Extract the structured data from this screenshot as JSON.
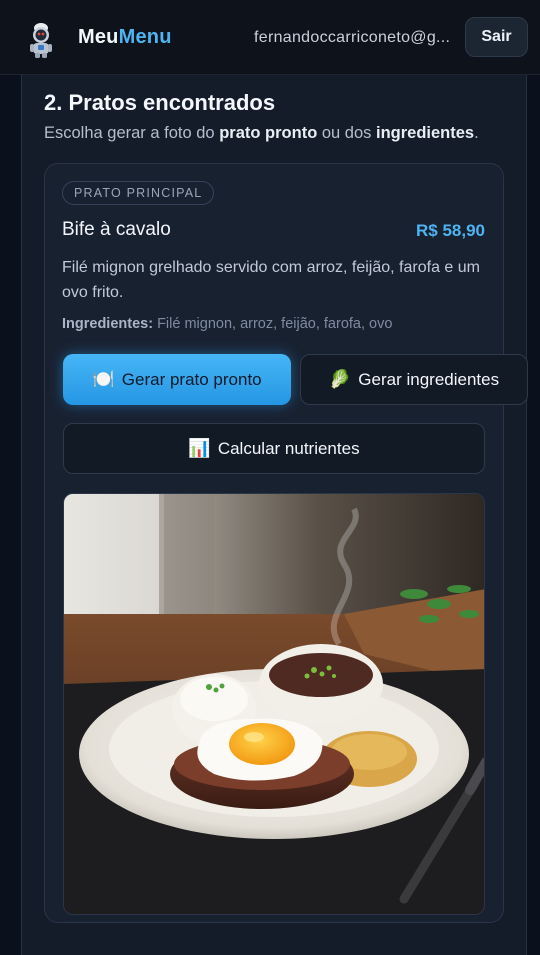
{
  "header": {
    "brand_part1": "Meu",
    "brand_part2": "Menu",
    "user_email": "fernandoccarriconeto@g...",
    "logout_label": "Sair"
  },
  "section": {
    "title": "2. Pratos encontrados",
    "subtitle_prefix": "Escolha gerar a foto do ",
    "subtitle_bold1": "prato pronto",
    "subtitle_mid": " ou dos ",
    "subtitle_bold2": "ingredientes",
    "subtitle_suffix": "."
  },
  "dish": {
    "category": "PRATO PRINCIPAL",
    "name": "Bife à cavalo",
    "price": "R$ 58,90",
    "description": "Filé mignon grelhado servido com arroz, feijão, farofa e um ovo frito.",
    "ingredients_label": "Ingredientes:",
    "ingredients_value": " Filé mignon, arroz, feijão, farofa, ovo"
  },
  "actions": {
    "generate_dish_emoji": "🍽️",
    "generate_dish_label": "Gerar prato pronto",
    "generate_ingredients_emoji": "🥬",
    "generate_ingredients_label": "Gerar ingredientes",
    "nutrients_emoji": "📊",
    "nutrients_label": "Calcular nutrientes"
  },
  "colors": {
    "accent": "#4fb3f0",
    "background": "#0b111c",
    "card": "#182130"
  },
  "icons": {
    "logo": "astronaut-chef-icon"
  }
}
